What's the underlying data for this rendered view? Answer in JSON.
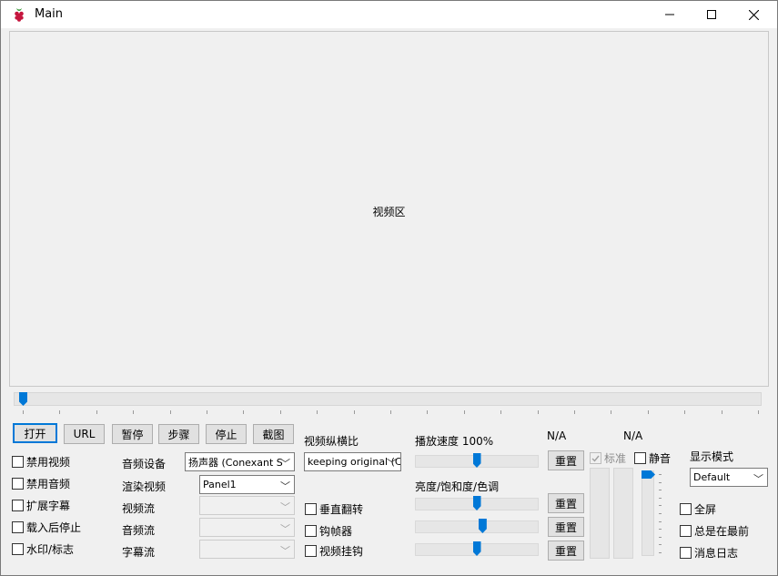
{
  "window": {
    "title": "Main",
    "minimize": "—",
    "maximize": "☐",
    "close": "✕"
  },
  "video": {
    "label": "视频区"
  },
  "seek": {
    "position": 0
  },
  "controls": {
    "open": "打开",
    "url": "URL",
    "pause": "暂停",
    "step": "步骤",
    "stop": "停止",
    "screenshot": "截图"
  },
  "left_checks": [
    "禁用视频",
    "禁用音频",
    "扩展字幕",
    "载入后停止",
    "水印/标志"
  ],
  "devices": {
    "audio_device_label": "音频设备",
    "audio_device_value": "扬声器 (Conexant S",
    "renderer_label": "渲染视频",
    "renderer_value": "Panel1",
    "video_stream_label": "视频流",
    "video_stream_value": "",
    "audio_stream_label": "音频流",
    "audio_stream_value": "",
    "subtitle_stream_label": "字幕流",
    "subtitle_stream_value": ""
  },
  "aspect": {
    "label": "视频纵横比",
    "value": "keeping original (C"
  },
  "mid_checks": [
    "垂直翻转",
    "钩帧器",
    "视频挂钩"
  ],
  "speed": {
    "label": "播放速度",
    "value": "100%",
    "level": 0.5
  },
  "color": {
    "label": "亮度/饱和度/色调",
    "brightness": 0.5,
    "saturation": 0.55,
    "hue": 0.5
  },
  "reset_label": "重置",
  "na": [
    "N/A",
    "N/A"
  ],
  "standard": {
    "label": "标准"
  },
  "mute": {
    "label": "静音"
  },
  "volume": {
    "level": 1.0
  },
  "display_mode": {
    "label": "显示模式",
    "value": "Default"
  },
  "right_checks": [
    "全屏",
    "总是在最前",
    "消息日志"
  ]
}
